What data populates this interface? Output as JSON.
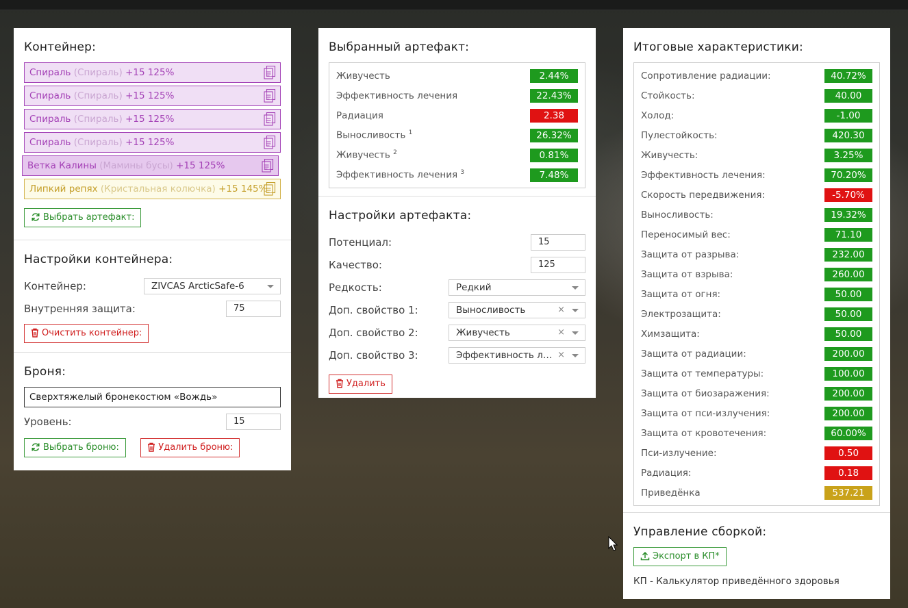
{
  "container": {
    "title": "Контейнер:",
    "slots": [
      {
        "name": "Спираль",
        "alt": "(Спираль)",
        "level": "+15 125%",
        "style": "purple"
      },
      {
        "name": "Спираль",
        "alt": "(Спираль)",
        "level": "+15 125%",
        "style": "purple"
      },
      {
        "name": "Спираль",
        "alt": "(Спираль)",
        "level": "+15 125%",
        "style": "purple"
      },
      {
        "name": "Спираль",
        "alt": "(Спираль)",
        "level": "+15 125%",
        "style": "purple"
      },
      {
        "name": "Ветка Калины",
        "alt": "(Мамины бусы)",
        "level": "+15 125%",
        "style": "purple-highlight"
      },
      {
        "name": "Липкий репях",
        "alt": "(Кристальная колючка)",
        "level": "+15 145%",
        "style": "gold"
      }
    ],
    "select_artifact_label": "Выбрать артефакт:"
  },
  "container_settings": {
    "title": "Настройки контейнера:",
    "container_label": "Контейнер:",
    "container_value": "ZIVCAS ArcticSafe-6",
    "protection_label": "Внутренняя защита:",
    "protection_value": "75",
    "clear_label": "Очистить контейнер:"
  },
  "armor": {
    "title": "Броня:",
    "name": "Сверхтяжелый бронекостюм «Вождь»",
    "level_label": "Уровень:",
    "level_value": "15",
    "select_label": "Выбрать броню:",
    "delete_label": "Удалить броню:"
  },
  "selected_artifact": {
    "title": "Выбранный артефакт:",
    "stats": [
      {
        "label": "Живучесть",
        "sup": "",
        "value": "2.44%",
        "color": "g"
      },
      {
        "label": "Эффективность лечения",
        "sup": "",
        "value": "22.43%",
        "color": "g"
      },
      {
        "label": "Радиация",
        "sup": "",
        "value": "2.38",
        "color": "r"
      },
      {
        "label": "Выносливость",
        "sup": "1",
        "value": "26.32%",
        "color": "g"
      },
      {
        "label": "Живучесть",
        "sup": "2",
        "value": "0.81%",
        "color": "g"
      },
      {
        "label": "Эффективность лечения",
        "sup": "3",
        "value": "7.48%",
        "color": "g"
      }
    ]
  },
  "artifact_settings": {
    "title": "Настройки артефакта:",
    "potential_label": "Потенциал:",
    "potential_value": "15",
    "quality_label": "Качество:",
    "quality_value": "125",
    "rarity_label": "Редкость:",
    "rarity_value": "Редкий",
    "prop1_label": "Доп. свойство 1:",
    "prop1_value": "Выносливость",
    "prop2_label": "Доп. свойство 2:",
    "prop2_value": "Живучесть",
    "prop3_label": "Доп. свойство 3:",
    "prop3_value": "Эффективность лечения",
    "clear_glyph": "×",
    "delete_label": "Удалить"
  },
  "totals": {
    "title": "Итоговые характеристики:",
    "stats": [
      {
        "label": "Сопротивление радиации:",
        "value": "40.72%",
        "color": "g"
      },
      {
        "label": "Стойкость:",
        "value": "40.00",
        "color": "g"
      },
      {
        "label": "Холод:",
        "value": "-1.00",
        "color": "g"
      },
      {
        "label": "Пулестойкость:",
        "value": "420.30",
        "color": "g"
      },
      {
        "label": "Живучесть:",
        "value": "3.25%",
        "color": "g"
      },
      {
        "label": "Эффективность лечения:",
        "value": "70.20%",
        "color": "g"
      },
      {
        "label": "Скорость передвижения:",
        "value": "-5.70%",
        "color": "r"
      },
      {
        "label": "Выносливость:",
        "value": "19.32%",
        "color": "g"
      },
      {
        "label": "Переносимый вес:",
        "value": "71.10",
        "color": "g"
      },
      {
        "label": "Защита от разрыва:",
        "value": "232.00",
        "color": "g"
      },
      {
        "label": "Защита от взрыва:",
        "value": "260.00",
        "color": "g"
      },
      {
        "label": "Защита от огня:",
        "value": "50.00",
        "color": "g"
      },
      {
        "label": "Электрозащита:",
        "value": "50.00",
        "color": "g"
      },
      {
        "label": "Химзащита:",
        "value": "50.00",
        "color": "g"
      },
      {
        "label": "Защита от радиации:",
        "value": "200.00",
        "color": "g"
      },
      {
        "label": "Защита от температуры:",
        "value": "100.00",
        "color": "g"
      },
      {
        "label": "Защита от биозаражения:",
        "value": "200.00",
        "color": "g"
      },
      {
        "label": "Защита от пси-излучения:",
        "value": "200.00",
        "color": "g"
      },
      {
        "label": "Защита от кровотечения:",
        "value": "60.00%",
        "color": "g"
      },
      {
        "label": "Пси-излучение:",
        "value": "0.50",
        "color": "r"
      },
      {
        "label": "Радиация:",
        "value": "0.18",
        "color": "r"
      },
      {
        "label": "Приведёнка",
        "value": "537.21",
        "color": "y"
      }
    ]
  },
  "build": {
    "title": "Управление сборкой:",
    "export_label": "Экспорт в КП*",
    "footnote": "КП - Калькулятор приведённого здоровья"
  },
  "colors": {
    "green": "#1e9a1e",
    "red": "#e01212",
    "gold": "#c9a21a",
    "purple": "#a441b6"
  }
}
